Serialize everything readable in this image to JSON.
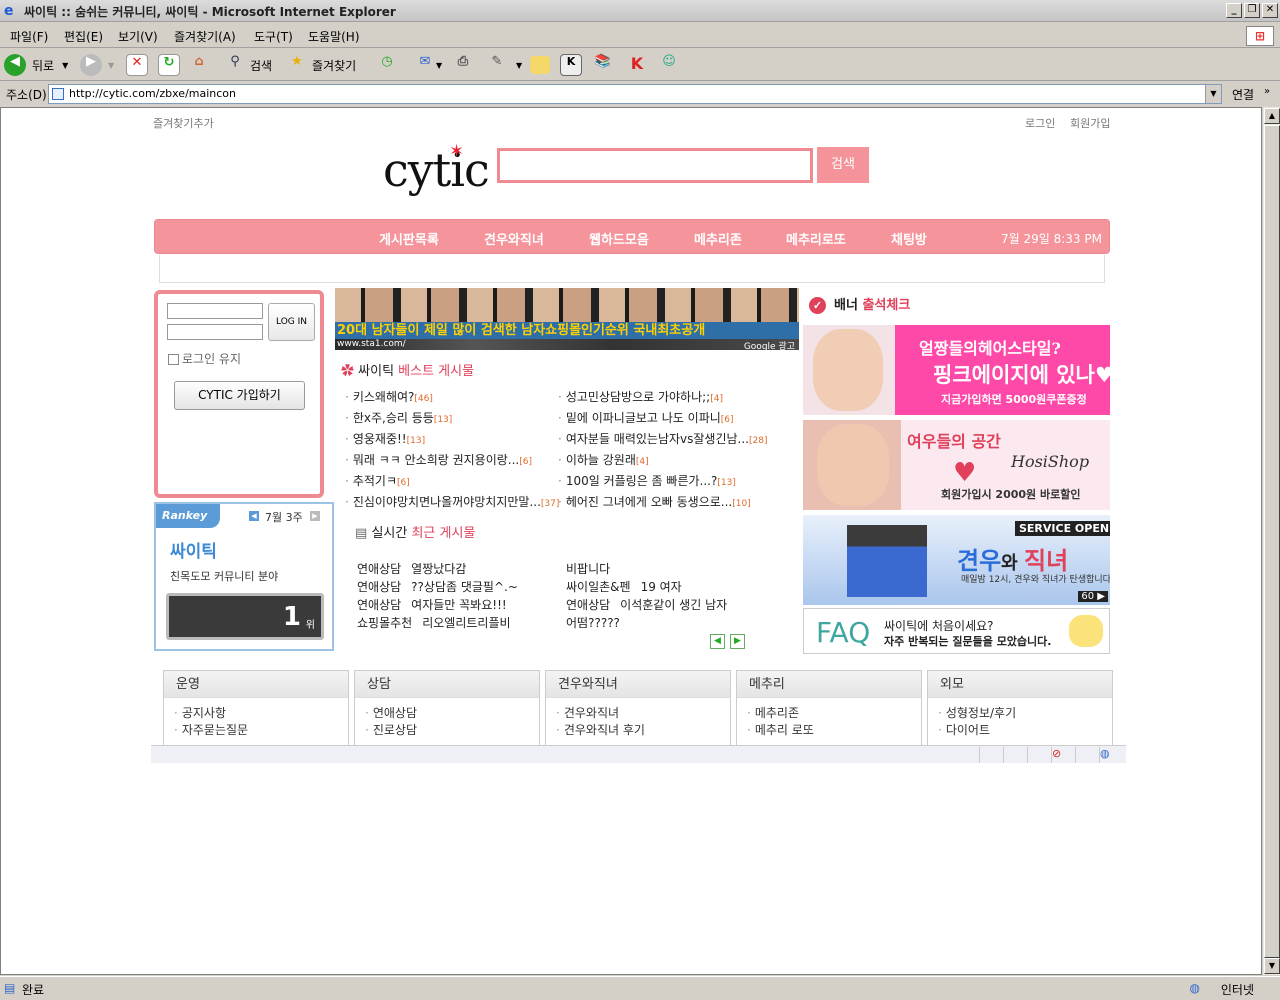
{
  "window": {
    "title": "싸이틱 :: 숨쉬는 커뮤니티, 싸이틱 - Microsoft Internet Explorer",
    "min": "_",
    "max": "❐",
    "close": "✕"
  },
  "menu": [
    "파일(F)",
    "편집(E)",
    "보기(V)",
    "즐겨찾기(A)",
    "도구(T)",
    "도움말(H)"
  ],
  "toolbar": {
    "back": "뒤로",
    "search": "검색",
    "favorites": "즐겨찾기"
  },
  "address": {
    "label": "주소(D)",
    "url": "http://cytic.com/zbxe/maincon",
    "go": "연결"
  },
  "page": {
    "top_left": "즐겨찾기추가",
    "login_link": "로그인",
    "signup_link": "회원가입",
    "logo": "cytic",
    "search_button": "검색",
    "nav": [
      "게시판목록",
      "견우와직녀",
      "웹하드모음",
      "메추리존",
      "메추리로또",
      "채팅방"
    ],
    "date": "7월 29일  8:33 PM",
    "login": {
      "button": "LOG IN",
      "keep": "로그인 유지",
      "join": "CYTIC 가입하기"
    },
    "rankey": {
      "brand": "Rankey",
      "week": "7월  3주",
      "name": "싸이틱",
      "desc": "친목도모 커뮤니티 분야",
      "rank": "1",
      "unit": "위"
    },
    "ad_banner": {
      "text": "20대 남자들이 제일 많이 검색한 남자쇼핑몰인기순위 국내최초공개",
      "url": "www.sta1.com/",
      "google": "Google 광고"
    },
    "best": {
      "title_a": "싸이틱 ",
      "title_b": "베스트 게시물",
      "left": [
        {
          "t": "키스왜해여?",
          "c": "[46]"
        },
        {
          "t": "한x주,승리 등등",
          "c": "[13]"
        },
        {
          "t": "영웅재중!!",
          "c": "[13]"
        },
        {
          "t": "뭐래 ㅋㅋ 안소희랑 권지용이랑...",
          "c": "[6]"
        },
        {
          "t": "추적기ㅋ",
          "c": "[6]"
        },
        {
          "t": "진심이야망치면나올꺼야망치지만말...",
          "c": "[37]"
        }
      ],
      "right": [
        {
          "t": "성고민상담방으로 가야하나;;",
          "c": "[4]"
        },
        {
          "t": "밑에 이파니글보고 나도 이파니",
          "c": "[6]"
        },
        {
          "t": "여자분들 매력있는남자vs잘생긴남...",
          "c": "[28]"
        },
        {
          "t": "이하늘 강원래",
          "c": "[4]"
        },
        {
          "t": "100일 커플링은 좀 빠른가...?",
          "c": "[13]"
        },
        {
          "t": "헤어진 그녀에게 오빠 동생으로...",
          "c": "[10]"
        }
      ]
    },
    "recent": {
      "title_a": "실시간 ",
      "title_b": "최근 게시물",
      "left": [
        {
          "cat": "연애상담",
          "t": "열짱났다감"
        },
        {
          "cat": "연애상담",
          "t": "??상담좀 댓글필^.~"
        },
        {
          "cat": "연애상담",
          "t": "여자들만 꼭봐요!!!"
        },
        {
          "cat": "쇼핑몰추천",
          "t": "리오엘리트리플비"
        }
      ],
      "right": [
        {
          "cat": "",
          "t": "비팝니다"
        },
        {
          "cat": "싸이일촌&펜",
          "t": "19 여자"
        },
        {
          "cat": "연애상담",
          "t": "이석훈같이 생긴 남자"
        },
        {
          "cat": "",
          "t": "어떰?????"
        }
      ]
    },
    "attend": {
      "a": "배너 ",
      "b": "출석체크"
    },
    "ads": {
      "a1": {
        "t1": "얼짱들의헤어스타일?",
        "t2": "핑크에이지에 있나♥",
        "t3": "지금가입하면 5000원쿠폰증정"
      },
      "a2": {
        "t1": "여우들의 공간",
        "t2": "HosiShop",
        "t3": "회원가입시 2000원 바로할인"
      },
      "a3": {
        "t0": "SERVICE OPEN",
        "t1a": "견우",
        "t1b": "와 ",
        "t1c": "직녀",
        "t2": "매일밤 12시, 견우와 직녀가 탄생합니다.",
        "t3": "60 ▶"
      },
      "a4": {
        "faq": "FAQ",
        "t1": "싸이틱에 처음이세요?",
        "t2": "자주 반복되는 질문들을 모았습니다."
      }
    },
    "categories": [
      {
        "head": "운영",
        "items": [
          "공지사항",
          "자주묻는질문"
        ]
      },
      {
        "head": "상담",
        "items": [
          "연애상담",
          "진로상담"
        ]
      },
      {
        "head": "견우와직녀",
        "items": [
          "견우와직녀",
          "견우와직녀 후기"
        ]
      },
      {
        "head": "메추리",
        "items": [
          "메추리존",
          "메추리 로또"
        ]
      },
      {
        "head": "외모",
        "items": [
          "성형정보/후기",
          "다이어트"
        ]
      }
    ]
  },
  "status": {
    "text": "완료",
    "zone": "인터넷"
  }
}
